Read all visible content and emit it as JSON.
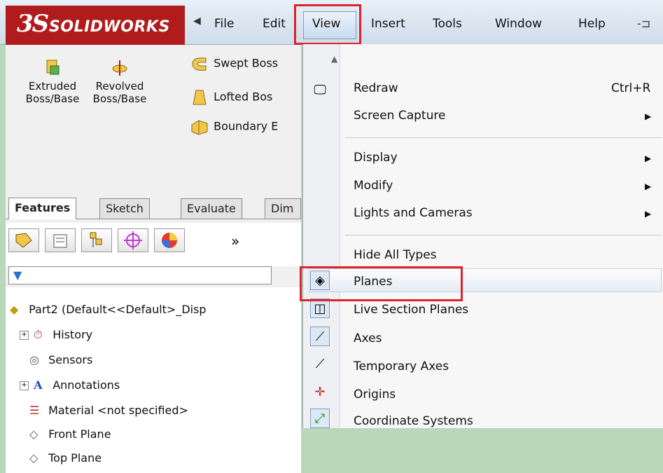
{
  "app": {
    "logo_mark": "3S",
    "logo_word": "SOLIDWORKS"
  },
  "menubar": {
    "items": [
      "File",
      "Edit",
      "View",
      "Insert",
      "Tools",
      "Window",
      "Help"
    ]
  },
  "ribbon": {
    "extruded_line1": "Extruded",
    "extruded_line2": "Boss/Base",
    "revolved_line1": "Revolved",
    "revolved_line2": "Boss/Base",
    "swept": "Swept Boss",
    "lofted": "Lofted Bos",
    "boundary": "Boundary E"
  },
  "tabs": [
    "Features",
    "Sketch",
    "Evaluate",
    "Dim"
  ],
  "fm_toolbar": {
    "more": "»"
  },
  "tree": {
    "root": "Part2  (Default<<Default>_Disp",
    "items": [
      {
        "label": "History",
        "expandable": true
      },
      {
        "label": "Sensors",
        "expandable": false
      },
      {
        "label": "Annotations",
        "expandable": true
      },
      {
        "label": "Material <not specified>",
        "expandable": false
      },
      {
        "label": "Front Plane",
        "expandable": false
      },
      {
        "label": "Top Plane",
        "expandable": false
      }
    ]
  },
  "view_menu": {
    "redraw": "Redraw",
    "redraw_shortcut": "Ctrl+R",
    "screen_capture": "Screen Capture",
    "display": "Display",
    "modify": "Modify",
    "lights_cameras": "Lights and Cameras",
    "hide_all_types": "Hide All Types",
    "planes": "Planes",
    "live_section_planes": "Live Section Planes",
    "axes": "Axes",
    "temporary_axes": "Temporary Axes",
    "origins": "Origins",
    "coordinate_systems": "Coordinate Systems"
  },
  "colors": {
    "highlight_red": "#e0222a",
    "brand_red": "#b01c1c"
  }
}
